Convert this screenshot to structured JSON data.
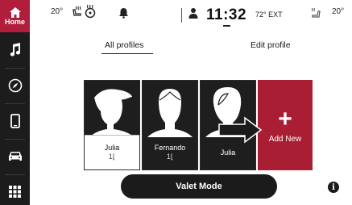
{
  "sidebar": {
    "home_label": "Home",
    "items": [
      {
        "icon": "music-note-icon"
      },
      {
        "icon": "compass-icon"
      },
      {
        "icon": "phone-icon"
      },
      {
        "icon": "car-icon"
      },
      {
        "icon": "apps-grid-icon"
      }
    ]
  },
  "status": {
    "left_temp": "20°",
    "clock": "11:32",
    "ext_temp": "72° EXT",
    "right_temp": "20°"
  },
  "tabs": {
    "all_profiles": "All profiles",
    "edit_profile": "Edit profile"
  },
  "profiles": [
    {
      "name": "Julia",
      "seat": "1"
    },
    {
      "name": "Fernando",
      "seat": "1"
    },
    {
      "name": "Julia"
    }
  ],
  "add_new": {
    "label": "Add New",
    "symbol": "+"
  },
  "valet": {
    "label": "Valet Mode"
  },
  "info": {
    "symbol": "i"
  },
  "colors": {
    "accent": "#a91e33",
    "sidebar": "#1c1c1c"
  }
}
